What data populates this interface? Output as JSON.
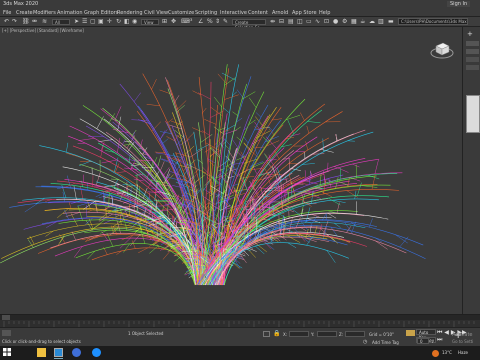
{
  "app": {
    "title": "3ds Max 2020",
    "signin": "Sign In"
  },
  "menus": [
    "File",
    "Create",
    "Modifiers",
    "Animation",
    "Graph Editors",
    "Rendering",
    "Civil View",
    "Customize",
    "Scripting",
    "Interactive",
    "Content",
    "Arnold",
    "App Store",
    "Help"
  ],
  "toolbar": {
    "filter": "All",
    "view": "View",
    "selection_set": "Create Selection Se"
  },
  "path_box": "C:\\Users\\PH\\Documents\\3ds Max 2020",
  "viewport": {
    "label": "[+] [Perspective] [Standard] [Wireframe]"
  },
  "status": {
    "selected": "1 Object Selected",
    "hint": "Click or click-and-drag to select objects",
    "x_label": "X:",
    "y_label": "Y:",
    "z_label": "Z:",
    "grid": "Grid = 0'10\"",
    "add_time_tag": "Add Time Tag",
    "auto_key": "Auto Key",
    "set_key": "Set Key",
    "frame": "0",
    "activate_line1": "Activate",
    "activate_line2": "Go to Setti"
  },
  "taskbar": {
    "temp": "13°C",
    "weather": "Haze"
  },
  "colors": {
    "accent": "#4a90d9",
    "viewport_bg": "#3b3b3b"
  }
}
